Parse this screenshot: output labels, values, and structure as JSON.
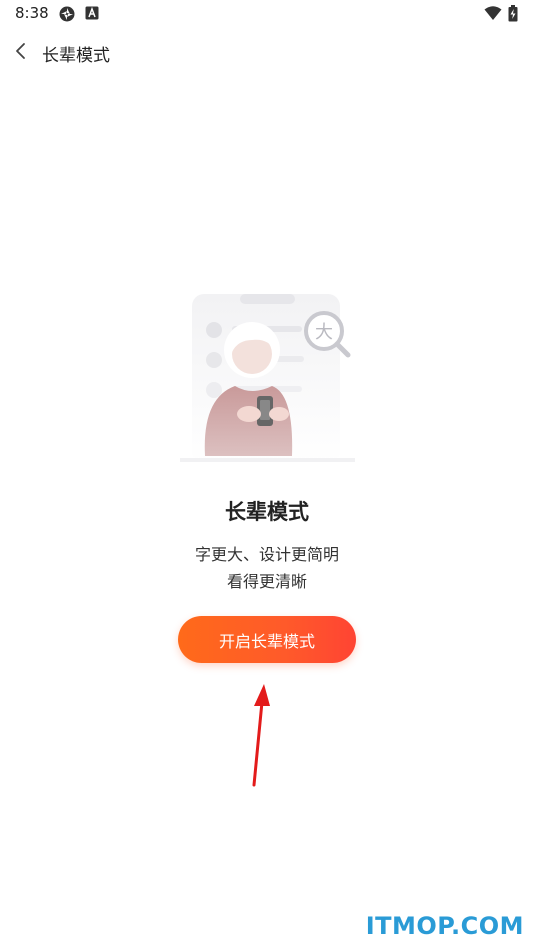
{
  "status_bar": {
    "time": "8:38"
  },
  "nav": {
    "title": "长辈模式"
  },
  "illustration": {
    "magnifier_char": "大"
  },
  "main": {
    "title": "长辈模式",
    "description_line1": "字更大、设计更简明",
    "description_line2": "看得更清晰",
    "button_label": "开启长辈模式"
  },
  "watermark": "ITMOP.COM",
  "colors": {
    "button_start": "#ff6a1a",
    "button_end": "#ff4433",
    "annotation_arrow": "#e31b1b",
    "watermark": "#2a9bd6"
  }
}
